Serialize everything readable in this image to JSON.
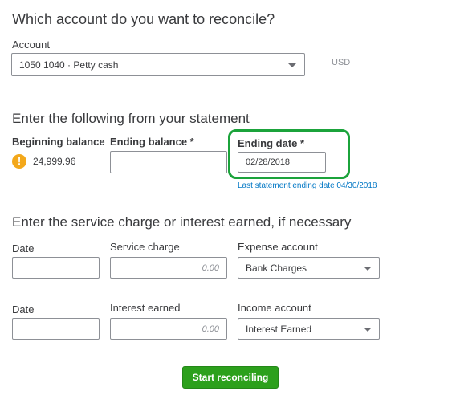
{
  "header": {
    "title": "Which account do you want to reconcile?"
  },
  "account": {
    "label": "Account",
    "value": "1050 1040 · Petty cash",
    "currency": "USD"
  },
  "statement": {
    "title": "Enter the following from your statement",
    "beginning_balance_label": "Beginning balance",
    "beginning_balance_value": "24,999.96",
    "ending_balance_label": "Ending balance *",
    "ending_balance_value": "",
    "ending_date_label": "Ending date *",
    "ending_date_value": "02/28/2018",
    "last_statement_link": "Last statement ending date 04/30/2018"
  },
  "charges": {
    "title": "Enter the service charge or interest earned, if necessary",
    "service": {
      "date_label": "Date",
      "amount_label": "Service charge",
      "amount_placeholder": "0.00",
      "account_label": "Expense account",
      "account_value": "Bank Charges"
    },
    "interest": {
      "date_label": "Date",
      "amount_label": "Interest earned",
      "amount_placeholder": "0.00",
      "account_label": "Income account",
      "account_value": "Interest Earned"
    }
  },
  "actions": {
    "start_label": "Start reconciling"
  },
  "colors": {
    "accent_green": "#2ca01c",
    "highlight_green": "#1ba33b",
    "link_blue": "#0077c5",
    "warning_orange": "#f3a81b"
  },
  "icons": {
    "warning": "exclamation-circle-icon",
    "dropdown": "chevron-down-icon"
  }
}
